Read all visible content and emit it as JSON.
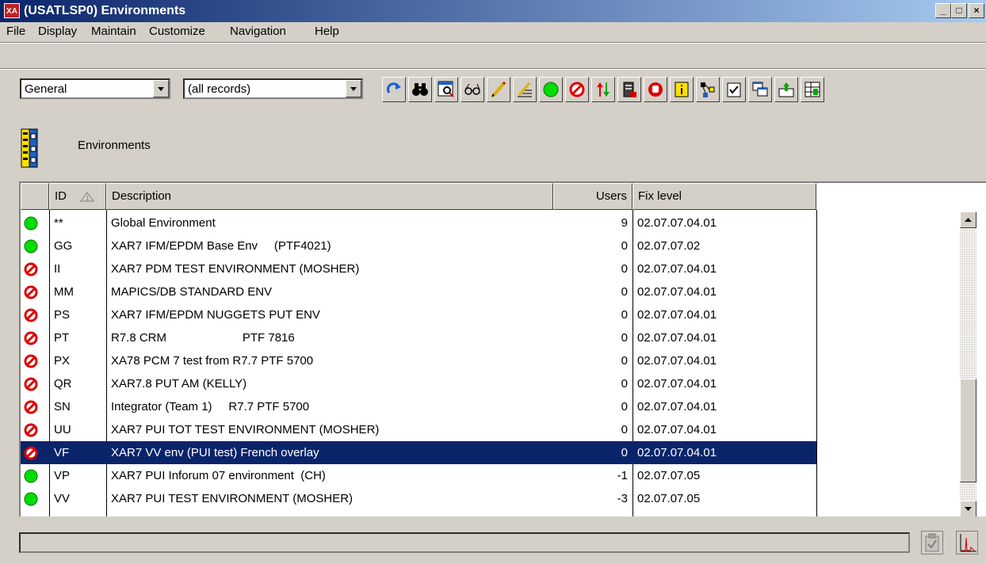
{
  "window": {
    "title": "(USATLSP0) Environments",
    "app_icon_text": "XA",
    "minimize": "_",
    "maximize": "□",
    "close": "×"
  },
  "menu": [
    "File",
    "Display",
    "Maintain",
    "Customize",
    "Navigation",
    "Help"
  ],
  "toolbar": {
    "view_select": "General",
    "filter_select": "(all records)",
    "buttons": [
      "refresh-icon",
      "binoculars-icon",
      "find-list-icon",
      "glasses-icon",
      "pencil-icon",
      "edit-lines-icon",
      "green-circle-icon",
      "no-entry-icon",
      "up-down-arrows-icon",
      "server-icon",
      "stop-hand-icon",
      "info-icon",
      "network-icon",
      "checklist-icon",
      "windows-icon",
      "export-icon",
      "table-tools-icon"
    ]
  },
  "section": {
    "title": "Environments",
    "icon": "environments-icon"
  },
  "table": {
    "columns": {
      "id": "ID",
      "description": "Description",
      "users": "Users",
      "fix_level": "Fix level"
    },
    "rows": [
      {
        "status": "active",
        "id": "**",
        "description": "Global Environment",
        "users": "9",
        "fix_level": "02.07.07.04.01"
      },
      {
        "status": "active",
        "id": "GG",
        "description": "XAR7 IFM/EPDM Base Env     (PTF4021)",
        "users": "0",
        "fix_level": "02.07.07.02"
      },
      {
        "status": "inactive",
        "id": "II",
        "description": "XAR7 PDM TEST ENVIRONMENT (MOSHER)",
        "users": "0",
        "fix_level": "02.07.07.04.01"
      },
      {
        "status": "inactive",
        "id": "MM",
        "description": "MAPICS/DB STANDARD ENV",
        "users": "0",
        "fix_level": "02.07.07.04.01"
      },
      {
        "status": "inactive",
        "id": "PS",
        "description": "XAR7 IFM/EPDM NUGGETS PUT ENV",
        "users": "0",
        "fix_level": "02.07.07.04.01"
      },
      {
        "status": "inactive",
        "id": "PT",
        "description": "R7.8 CRM                       PTF 7816",
        "users": "0",
        "fix_level": "02.07.07.04.01"
      },
      {
        "status": "inactive",
        "id": "PX",
        "description": "XA78 PCM 7 test from R7.7 PTF 5700",
        "users": "0",
        "fix_level": "02.07.07.04.01"
      },
      {
        "status": "inactive",
        "id": "QR",
        "description": "XAR7.8 PUT AM (KELLY)",
        "users": "0",
        "fix_level": "02.07.07.04.01"
      },
      {
        "status": "inactive",
        "id": "SN",
        "description": "Integrator (Team 1)     R7.7 PTF 5700",
        "users": "0",
        "fix_level": "02.07.07.04.01"
      },
      {
        "status": "inactive",
        "id": "UU",
        "description": "XAR7 PUI TOT TEST ENVIRONMENT (MOSHER)",
        "users": "0",
        "fix_level": "02.07.07.04.01"
      },
      {
        "status": "inactive",
        "id": "VF",
        "description": "XAR7 VV env (PUI test) French overlay",
        "users": "0",
        "fix_level": "02.07.07.04.01",
        "selected": true
      },
      {
        "status": "active",
        "id": "VP",
        "description": "XAR7 PUI Inforum 07 environment  (CH)",
        "users": "-1",
        "fix_level": "02.07.07.05"
      },
      {
        "status": "active",
        "id": "VV",
        "description": "XAR7 PUI TEST ENVIRONMENT (MOSHER)",
        "users": "-3",
        "fix_level": "02.07.07.05"
      }
    ]
  },
  "statusbar": {
    "text": "",
    "icons": [
      "clipboard-check-icon",
      "graph-icon"
    ]
  },
  "colors": {
    "titlebar_start": "#0a246a",
    "titlebar_end": "#a6caf0",
    "selection": "#0a246a",
    "active": "#00dd00",
    "inactive": "#dd0000",
    "face": "#d4d0c8"
  }
}
